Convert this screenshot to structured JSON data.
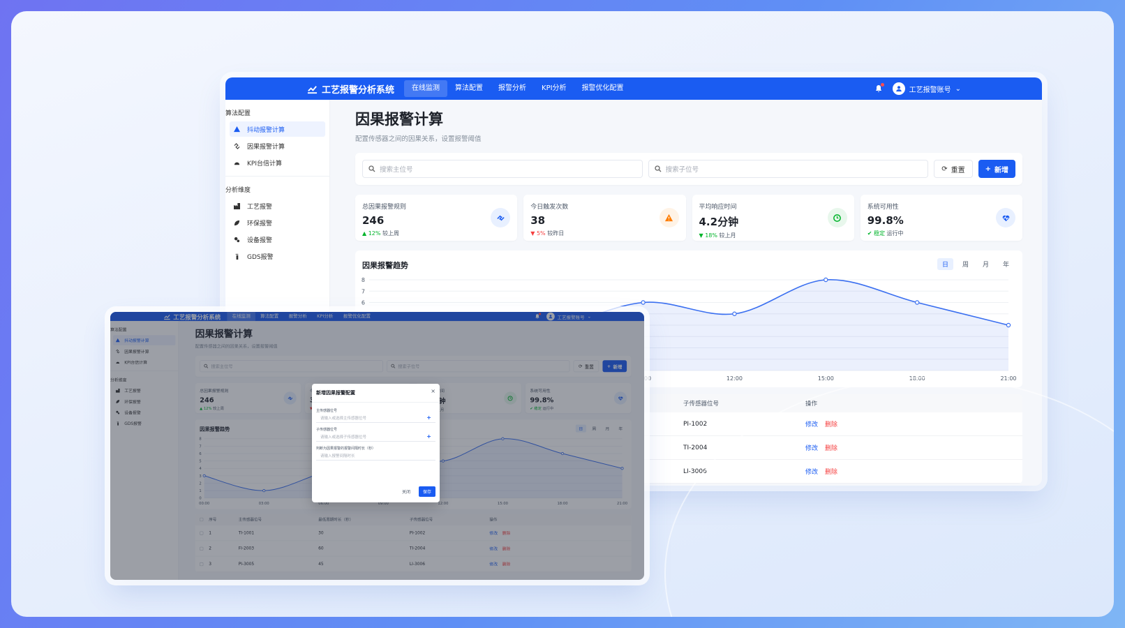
{
  "app": {
    "title": "工艺报警分析系统",
    "nav": [
      "在线监测",
      "算法配置",
      "报警分析",
      "KPI分析",
      "报警优化配置"
    ],
    "user": "工艺报警账号"
  },
  "sidebar": {
    "group1": "算法配置",
    "group1_items": [
      "抖动报警计算",
      "因果报警计算",
      "KPI台倍计算"
    ],
    "group2": "分析维度",
    "group2_items": [
      "工艺报警",
      "环保报警",
      "设备报警",
      "GDS报警"
    ]
  },
  "page": {
    "title": "因果报警计算",
    "subtitle": "配置传感器之间的因果关系，设置报警阈值"
  },
  "filter": {
    "main_placeholder": "搜索主位号",
    "sub_placeholder": "搜索子位号",
    "reset": "重置",
    "add": "新增"
  },
  "stats": [
    {
      "label": "总因果报警规则",
      "value": "246",
      "trend": "12%",
      "trend_text": "较上周",
      "dir": "up",
      "color": "#1a5cf2",
      "bg": "#e8f0ff",
      "icon": "link-icon"
    },
    {
      "label": "今日触发次数",
      "value": "38",
      "trend": "5%",
      "trend_text": "较昨日",
      "dir": "down",
      "color": "#ff7d00",
      "bg": "#fff3e6",
      "icon": "warning-icon"
    },
    {
      "label": "平均响应时间",
      "value": "4.2分钟",
      "trend": "18%",
      "trend_text": "较上月",
      "dir": "down-good",
      "color": "#00b42a",
      "bg": "#e8f7ec",
      "icon": "clock-icon"
    },
    {
      "label": "系统可用性",
      "value": "99.8%",
      "trend": "稳定",
      "trend_text": "运行中",
      "dir": "check",
      "color": "#1a5cf2",
      "bg": "#e8f0ff",
      "icon": "heart-pulse-icon"
    }
  ],
  "chart": {
    "title": "因果报警趋势",
    "tabs": [
      "日",
      "周",
      "月",
      "年"
    ],
    "active_tab": "日"
  },
  "chart_data": {
    "type": "area",
    "x": [
      "00:00",
      "03:00",
      "06:00",
      "09:00",
      "12:00",
      "15:00",
      "18:00",
      "21:00"
    ],
    "values": [
      3,
      1,
      3.5,
      6,
      5,
      8,
      6,
      4
    ],
    "ylim": [
      0,
      8
    ],
    "yticks": [
      0,
      1,
      2,
      3,
      4,
      5,
      6,
      7,
      8
    ],
    "color": "#3a6ff0",
    "grid": true
  },
  "table": {
    "headers": [
      "序号",
      "主传感器位号",
      "最低周期时长（秒）",
      "子传感器位号",
      "操作"
    ],
    "rows": [
      {
        "idx": "1",
        "main": "TI-1001",
        "window": "30",
        "sub": "PI-1002"
      },
      {
        "idx": "2",
        "main": "FI-2003",
        "window": "60",
        "sub": "TI-2004"
      },
      {
        "idx": "3",
        "main": "PI-3005",
        "window": "45",
        "sub": "LI-3006"
      }
    ],
    "edit": "修改",
    "delete": "删除"
  },
  "dialog": {
    "title": "新增因果报警配置",
    "close": "×",
    "label_main": "主传感器位号",
    "ph_main": "请输入或选择主传感器位号",
    "label_sub": "子传感器位号",
    "ph_sub": "请输入或选择子传感器位号",
    "label_window": "判断为因果报警的报警间隔时长（秒）",
    "ph_window": "请输入报警间隔时长",
    "cancel": "关闭",
    "save": "保存"
  }
}
